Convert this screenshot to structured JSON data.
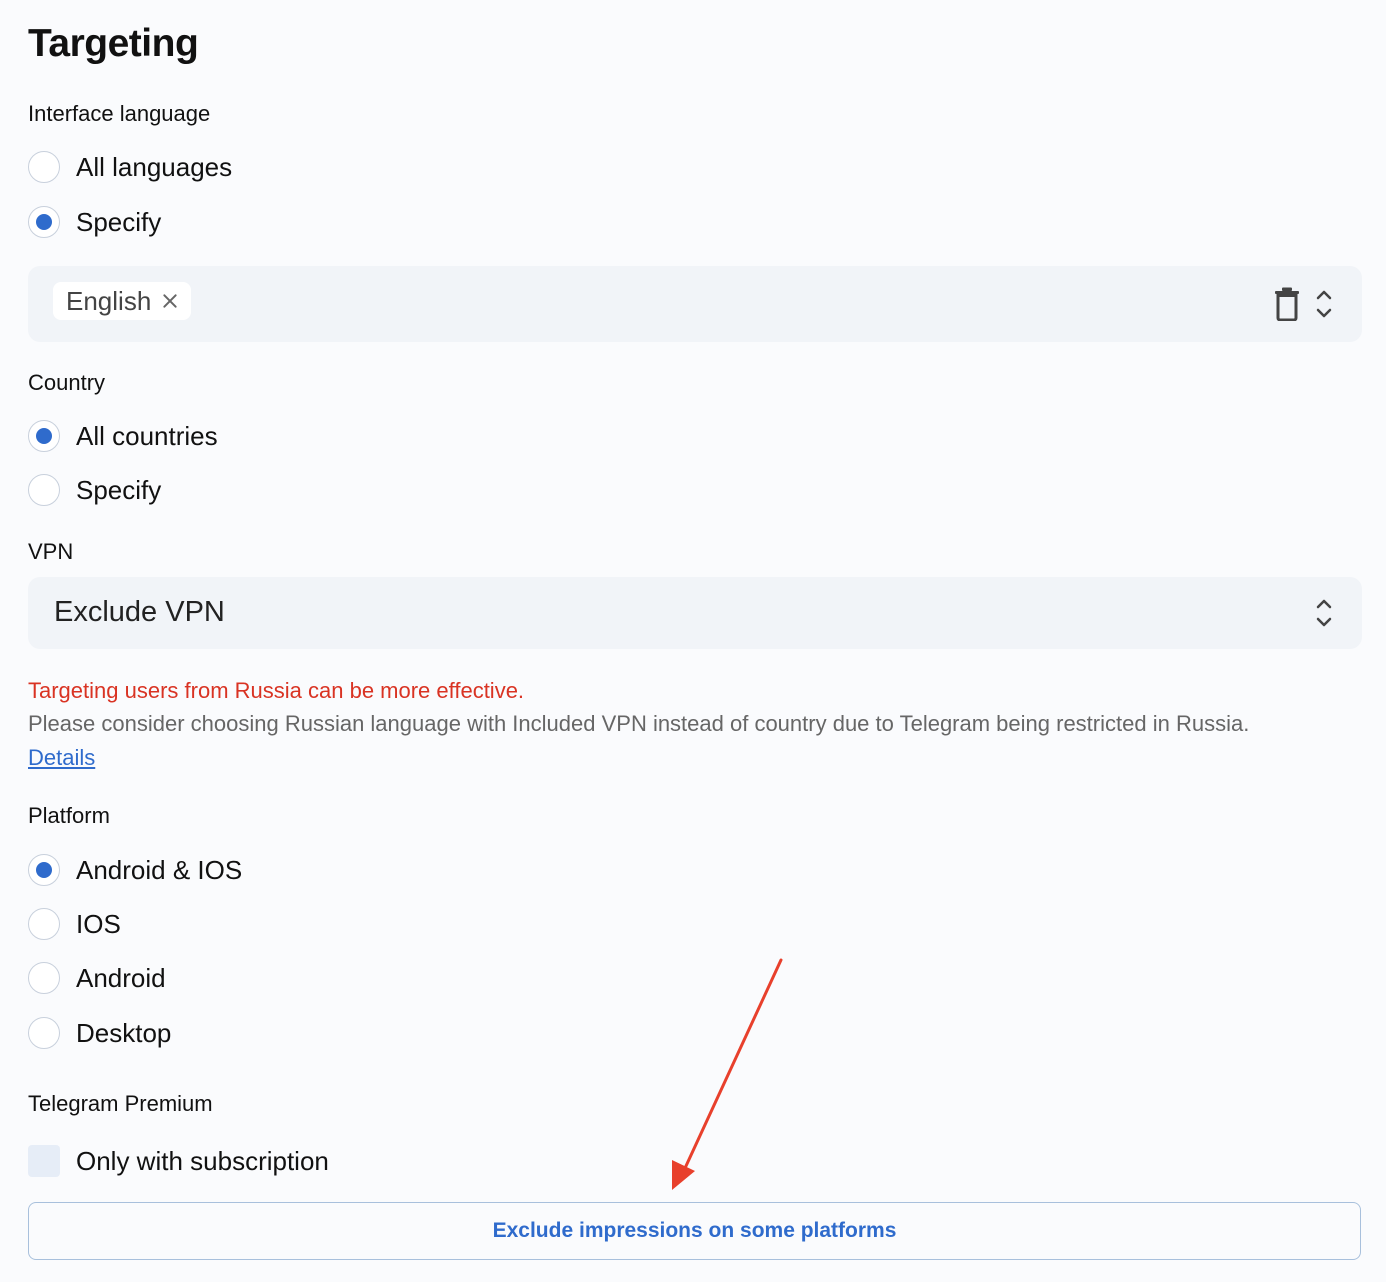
{
  "title": "Targeting",
  "interface_language": {
    "label": "Interface language",
    "options": [
      {
        "label": "All languages",
        "checked": false
      },
      {
        "label": "Specify",
        "checked": true
      }
    ],
    "selected_chips": [
      "English"
    ]
  },
  "country": {
    "label": "Country",
    "options": [
      {
        "label": "All countries",
        "checked": true
      },
      {
        "label": "Specify",
        "checked": false
      }
    ]
  },
  "vpn": {
    "label": "VPN",
    "value": "Exclude VPN"
  },
  "warning": {
    "title": "Targeting users from Russia can be more effective.",
    "text": "Please consider choosing Russian language with Included VPN instead of country due to Telegram being restricted in Russia.",
    "link": "Details"
  },
  "platform": {
    "label": "Platform",
    "options": [
      {
        "label": "Android & IOS",
        "checked": true
      },
      {
        "label": "IOS",
        "checked": false
      },
      {
        "label": "Android",
        "checked": false
      },
      {
        "label": "Desktop",
        "checked": false
      }
    ]
  },
  "telegram_premium": {
    "label": "Telegram Premium",
    "checkbox_label": "Only with subscription",
    "checked": false
  },
  "exclude_button": "Exclude impressions on some platforms",
  "colors": {
    "accent": "#2f6bcc",
    "warning": "#d93323",
    "annotation_arrow": "#e8402c"
  },
  "icons": {
    "remove_chip": "close-icon",
    "clear": "trash-icon",
    "select": "chevron-up-down-icon",
    "annotation": "arrow-annotation-icon"
  }
}
